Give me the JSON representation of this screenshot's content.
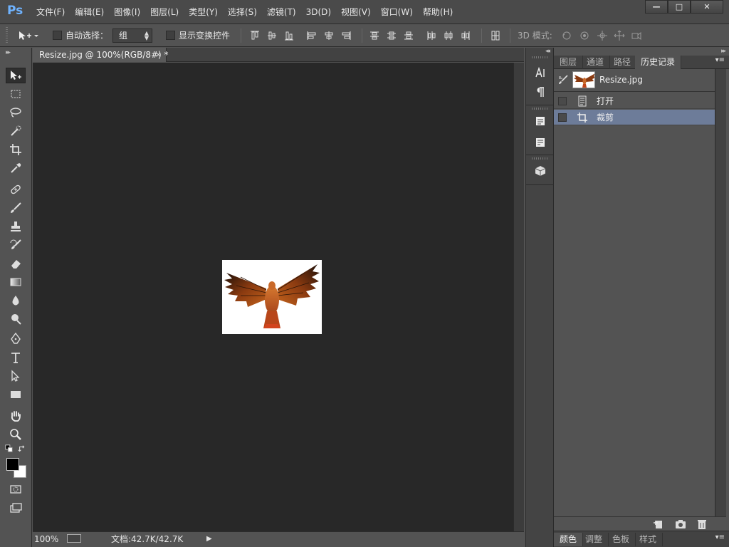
{
  "app": {
    "logo": "Ps",
    "menu": [
      "文件(F)",
      "编辑(E)",
      "图像(I)",
      "图层(L)",
      "类型(Y)",
      "选择(S)",
      "滤镜(T)",
      "3D(D)",
      "视图(V)",
      "窗口(W)",
      "帮助(H)"
    ],
    "window_controls": [
      "—",
      "□",
      "✕"
    ]
  },
  "options_bar": {
    "auto_select_label": "自动选择：",
    "auto_select_value": "组",
    "show_transform_label": "显示变换控件",
    "mode_3d_label": "3D 模式:"
  },
  "document": {
    "tab_title": "Resize.jpg @ 100%(RGB/8#) *",
    "tab_close": "×",
    "zoom": "100%",
    "doc_info": "文档:42.7K/42.7K"
  },
  "panel": {
    "tabs": [
      "图层",
      "通道",
      "路径",
      "历史记录"
    ],
    "active_tab": "历史记录",
    "snapshot_name": "Resize.jpg",
    "history": [
      {
        "label": "打开",
        "icon": "document-icon",
        "selected": false
      },
      {
        "label": "裁剪",
        "icon": "crop-icon",
        "selected": true
      }
    ],
    "bottom_tabs": [
      "颜色",
      "调整",
      "色板",
      "样式"
    ],
    "bottom_active": "颜色"
  },
  "colors": {
    "selection": "#6d7c99",
    "canvas_bg": "#282828",
    "ui_bg": "#535353",
    "foreground": "#000000",
    "background": "#ffffff"
  }
}
